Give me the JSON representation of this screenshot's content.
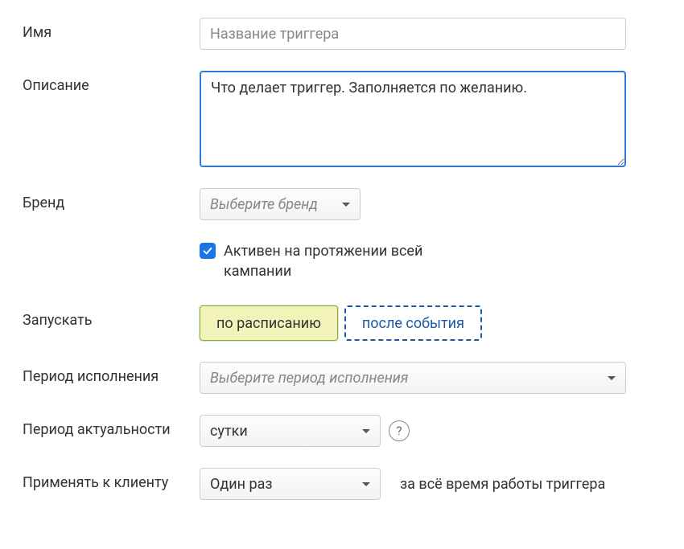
{
  "name": {
    "label": "Имя",
    "placeholder": "Название триггера",
    "value": ""
  },
  "description": {
    "label": "Описание",
    "value": "Что делает триггер. Заполняется по желанию."
  },
  "brand": {
    "label": "Бренд",
    "placeholder": "Выберите бренд"
  },
  "active_checkbox": {
    "checked": true,
    "label": "Активен на протяжении всей кампании"
  },
  "launch": {
    "label": "Запускать",
    "option_schedule": "по расписанию",
    "option_event": "после события"
  },
  "exec_period": {
    "label": "Период исполнения",
    "placeholder": "Выберите период исполнения"
  },
  "validity_period": {
    "label": "Период актуальности",
    "value": "сутки",
    "help": "?"
  },
  "apply_to_client": {
    "label": "Применять к клиенту",
    "value": "Один раз",
    "note": "за всё время работы триггера"
  }
}
